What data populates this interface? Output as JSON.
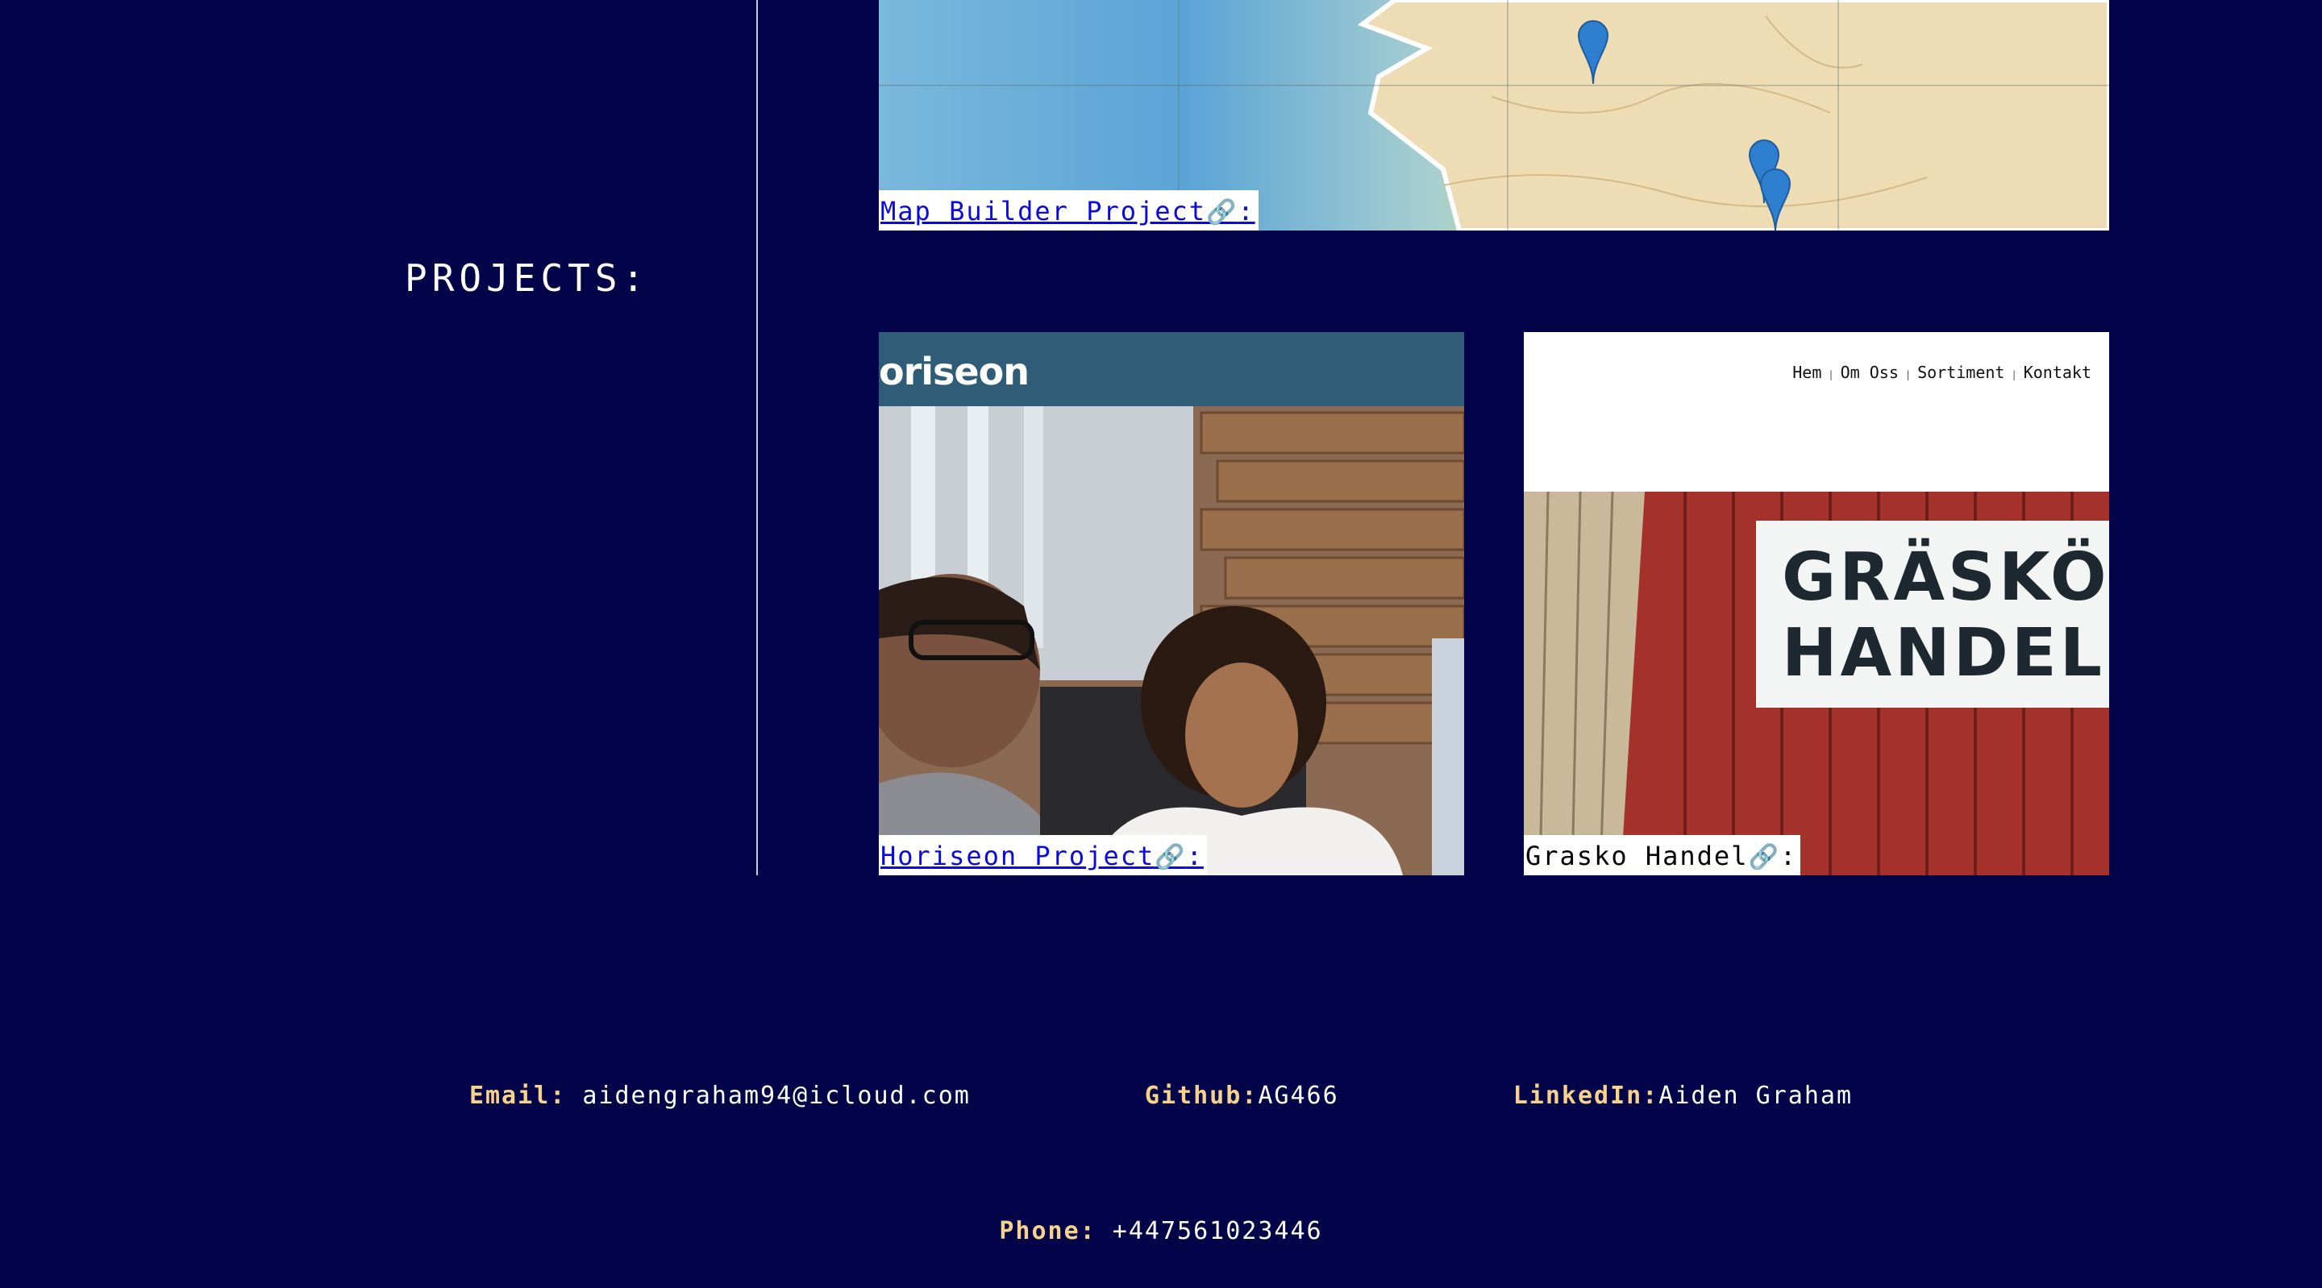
{
  "projects_heading": "PROJECTS:",
  "projects": [
    {
      "id": "map",
      "caption": "Map Builder Project",
      "icon_glyph": "🔗",
      "suffix": ":",
      "style": "link"
    },
    {
      "id": "horiseon",
      "caption": "Horiseon Project",
      "icon_glyph": "🔗",
      "suffix": ":",
      "style": "link",
      "brand_text": "oriseon"
    },
    {
      "id": "grasko",
      "caption": "Grasko Handel",
      "icon_glyph": "🔗",
      "suffix": ":",
      "style": "plain",
      "nav_items": [
        "Hem",
        "Om Oss",
        "Sortiment",
        "Kontakt"
      ],
      "sign_lines": [
        "GRÄSKÖ",
        "HANDEL"
      ]
    }
  ],
  "contact": {
    "email_label": "Email:",
    "email_value": " aidengraham94@icloud.com",
    "github_label": "Github:",
    "github_value": "AG466",
    "linkedin_label": "LinkedIn:",
    "linkedin_value": "Aiden Graham",
    "phone_label": "Phone:",
    "phone_value": " +447561023446"
  },
  "colors": {
    "background": "#03034a",
    "label_accent": "#f7d28a",
    "link": "#0a0ae0"
  }
}
